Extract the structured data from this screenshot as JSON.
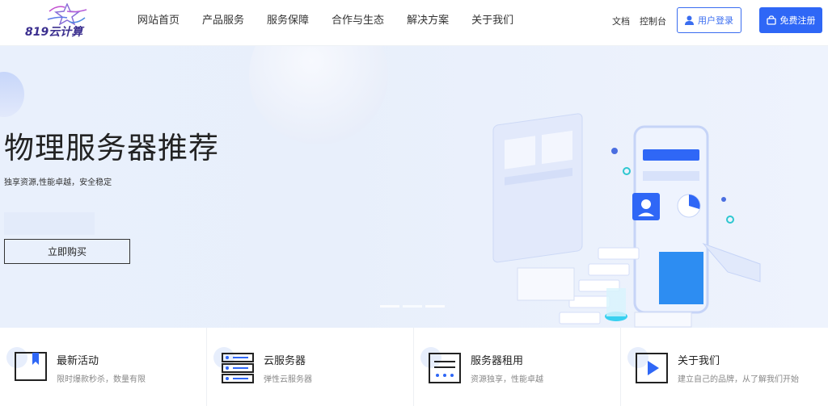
{
  "header": {
    "logo_text": "819云计算",
    "nav": [
      "网站首页",
      "产品服务",
      "服务保障",
      "合作与生态",
      "解决方案",
      "关于我们"
    ],
    "links": [
      "文档",
      "控制台"
    ],
    "login_label": "用户登录",
    "register_label": "免费注册"
  },
  "banner": {
    "title": "物理服务器推荐",
    "subtitle": "独享资源,性能卓越，安全稳定",
    "buy_label": "立即购买",
    "slide_count": 3,
    "active_slide": 2
  },
  "features": [
    {
      "title": "最新活动",
      "desc": "限时爆款秒杀，数量有限",
      "icon": "bookmark-icon"
    },
    {
      "title": "云服务器",
      "desc": "弹性云服务器",
      "icon": "server-icon"
    },
    {
      "title": "服务器租用",
      "desc": "资源独享，性能卓越",
      "icon": "window-icon"
    },
    {
      "title": "关于我们",
      "desc": "建立自己的品牌，从了解我们开始",
      "icon": "play-icon"
    }
  ],
  "colors": {
    "primary": "#2f67f6",
    "banner_bg": "#e9f0fc"
  }
}
